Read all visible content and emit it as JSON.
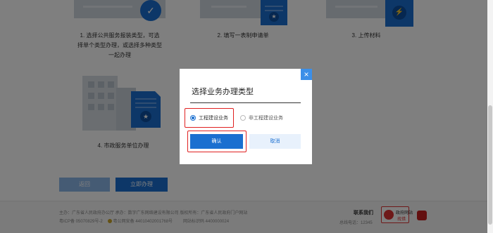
{
  "steps": [
    {
      "number": "1.",
      "caption_lines": [
        "选择公共服务报装类型，可选",
        "择单个类型办理，或选择多种类型",
        "一起办理"
      ]
    },
    {
      "number": "2.",
      "caption_lines": [
        "填写一表制申请单"
      ]
    },
    {
      "number": "3.",
      "caption_lines": [
        "上传材料"
      ]
    },
    {
      "number": "4.",
      "caption_lines": [
        "市政服务单位办理"
      ]
    }
  ],
  "step_icons": [
    "check-icon",
    "arrow-icon",
    "lightning-icon",
    "star-icon"
  ],
  "actions": {
    "back_label": "返回",
    "go_label": "立即办理"
  },
  "footer": {
    "line1": "主办：广东省人民政府办公厅    承办：数字广东网络建设有限公司    版权所有：广东省人民政府门户网站",
    "line2_icp": "粤ICP备 05070829号-2",
    "line2_police": "粤公网安备 44010402001768号",
    "line2_code": "网站标识码 4400000024",
    "contact_label": "联系我们",
    "phone": "总线电话：12345",
    "gov_badge_line1": "政府网站",
    "gov_badge_line2": "找错"
  },
  "modal": {
    "title": "选择业务办理类型",
    "close_label": "×",
    "options": [
      {
        "label": "工程建设业务",
        "checked": true
      },
      {
        "label": "非工程建设业务",
        "checked": false
      }
    ],
    "confirm_label": "确认",
    "cancel_label": "取消"
  },
  "colors": {
    "primary": "#1a6fd0",
    "highlight": "#e02020",
    "overlay": "rgba(0,0,0,0.5)"
  }
}
